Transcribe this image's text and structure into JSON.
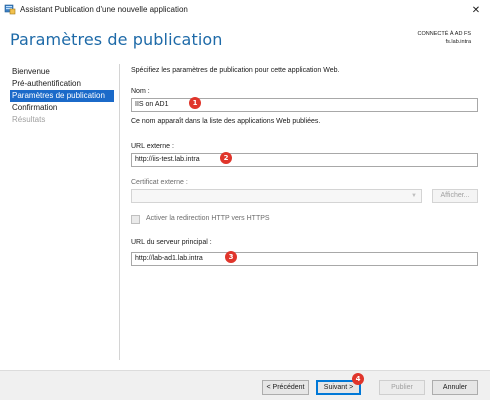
{
  "window": {
    "title": "Assistant Publication d'une nouvelle application",
    "app_icon": "server-app-icon",
    "close_glyph": "✕"
  },
  "header": {
    "title": "Paramètres de publication",
    "connection_label": "CONNECTÉ À AD FS",
    "connection_server": "fs.lab.intra"
  },
  "nav": {
    "items": [
      {
        "label": "Bienvenue",
        "state": "normal"
      },
      {
        "label": "Pré-authentification",
        "state": "normal"
      },
      {
        "label": "Paramètres de publication",
        "state": "active"
      },
      {
        "label": "Confirmation",
        "state": "normal"
      },
      {
        "label": "Résultats",
        "state": "disabled"
      }
    ]
  },
  "form": {
    "intro": "Spécifiez les paramètres de publication pour cette application Web.",
    "name_label": "Nom :",
    "name_value": "IIS on AD1",
    "name_help": "Ce nom apparaît dans la liste des applications Web publiées.",
    "external_url_label": "URL externe :",
    "external_url_value": "http://iis-test.lab.intra",
    "external_cert_label": "Certificat externe :",
    "external_cert_value": "",
    "show_button": "Afficher...",
    "http_redirect_label": "Activer la redirection HTTP vers HTTPS",
    "http_redirect_checked": false,
    "backend_url_label": "URL du serveur principal :",
    "backend_url_value": "http://lab-ad1.lab.intra"
  },
  "annotations": {
    "badge1": "1",
    "badge2": "2",
    "badge3": "3",
    "badge4": "4",
    "color": "#e0352b"
  },
  "footer": {
    "prev": "< Précédent",
    "next": "Suivant >",
    "publish": "Publier",
    "cancel": "Annuler"
  },
  "colors": {
    "accent": "#1e6aa8",
    "nav_active": "#1b6ac9",
    "disabled_text": "#a0a0a0"
  }
}
